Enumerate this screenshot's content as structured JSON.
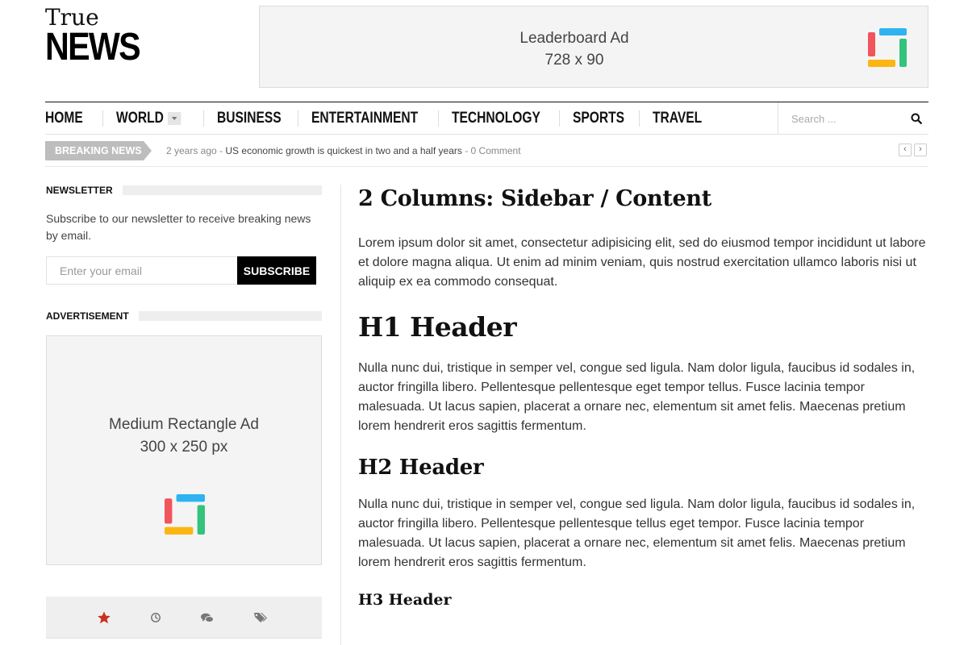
{
  "logo": {
    "line1": "True",
    "line2": "NEWS"
  },
  "leaderboard_ad": {
    "line1": "Leaderboard Ad",
    "line2": "728 x 90"
  },
  "nav": {
    "items": [
      "HOME",
      "WORLD",
      "BUSINESS",
      "ENTERTAINMENT",
      "TECHNOLOGY",
      "SPORTS",
      "TRAVEL"
    ],
    "search_placeholder": "Search ..."
  },
  "breaking": {
    "label": "BREAKING NEWS",
    "time": "2 years ago",
    "separator": " - ",
    "headline": "US economic growth is quickest in two and a half years",
    "comments": "0 Comment",
    "prev": "‹",
    "next": "›"
  },
  "sidebar": {
    "newsletter": {
      "title": "NEWSLETTER",
      "description": "Subscribe to our newsletter to receive breaking news by email.",
      "email_placeholder": "Enter your email",
      "button": "SUBSCRIBE"
    },
    "advertisement": {
      "title": "ADVERTISEMENT",
      "line1": "Medium Rectangle Ad",
      "line2": "300 x 250 px"
    },
    "tabs": [
      "star-icon",
      "clock-icon",
      "comments-icon",
      "tags-icon"
    ],
    "active_tab_color": "#c8321e"
  },
  "content": {
    "title": "2 Columns: Sidebar / Content",
    "p1": "Lorem ipsum dolor sit amet, consectetur adipisicing elit, sed do eiusmod tempor incididunt ut labore et dolore magna aliqua. Ut enim ad minim veniam, quis nostrud exercitation ullamco laboris nisi ut aliquip ex ea commodo consequat.",
    "h1": "H1 Header",
    "p2": "Nulla nunc dui, tristique in semper vel, congue sed ligula. Nam dolor ligula, faucibus id sodales in, auctor fringilla libero. Pellentesque pellentesque eget tempor tellus. Fusce lacinia tempor malesuada. Ut lacus sapien, placerat a ornare nec, elementum sit amet felis. Maecenas pretium lorem hendrerit eros sagittis fermentum.",
    "h2": "H2 Header",
    "p3": "Nulla nunc dui, tristique in semper vel, congue sed ligula. Nam dolor ligula, faucibus id sodales in, auctor fringilla libero. Pellentesque pellentesque tellus eget tempor. Fusce lacinia tempor malesuada. Ut lacus sapien, placerat a ornare nec, elementum sit amet felis. Maecenas pretium lorem hendrerit eros sagittis fermentum.",
    "h3": "H3 Header"
  },
  "colors": {
    "ad_logo_red": "#f2545b",
    "ad_logo_blue": "#2eb3f0",
    "ad_logo_yellow": "#fbb613",
    "ad_logo_green": "#34c37c"
  }
}
